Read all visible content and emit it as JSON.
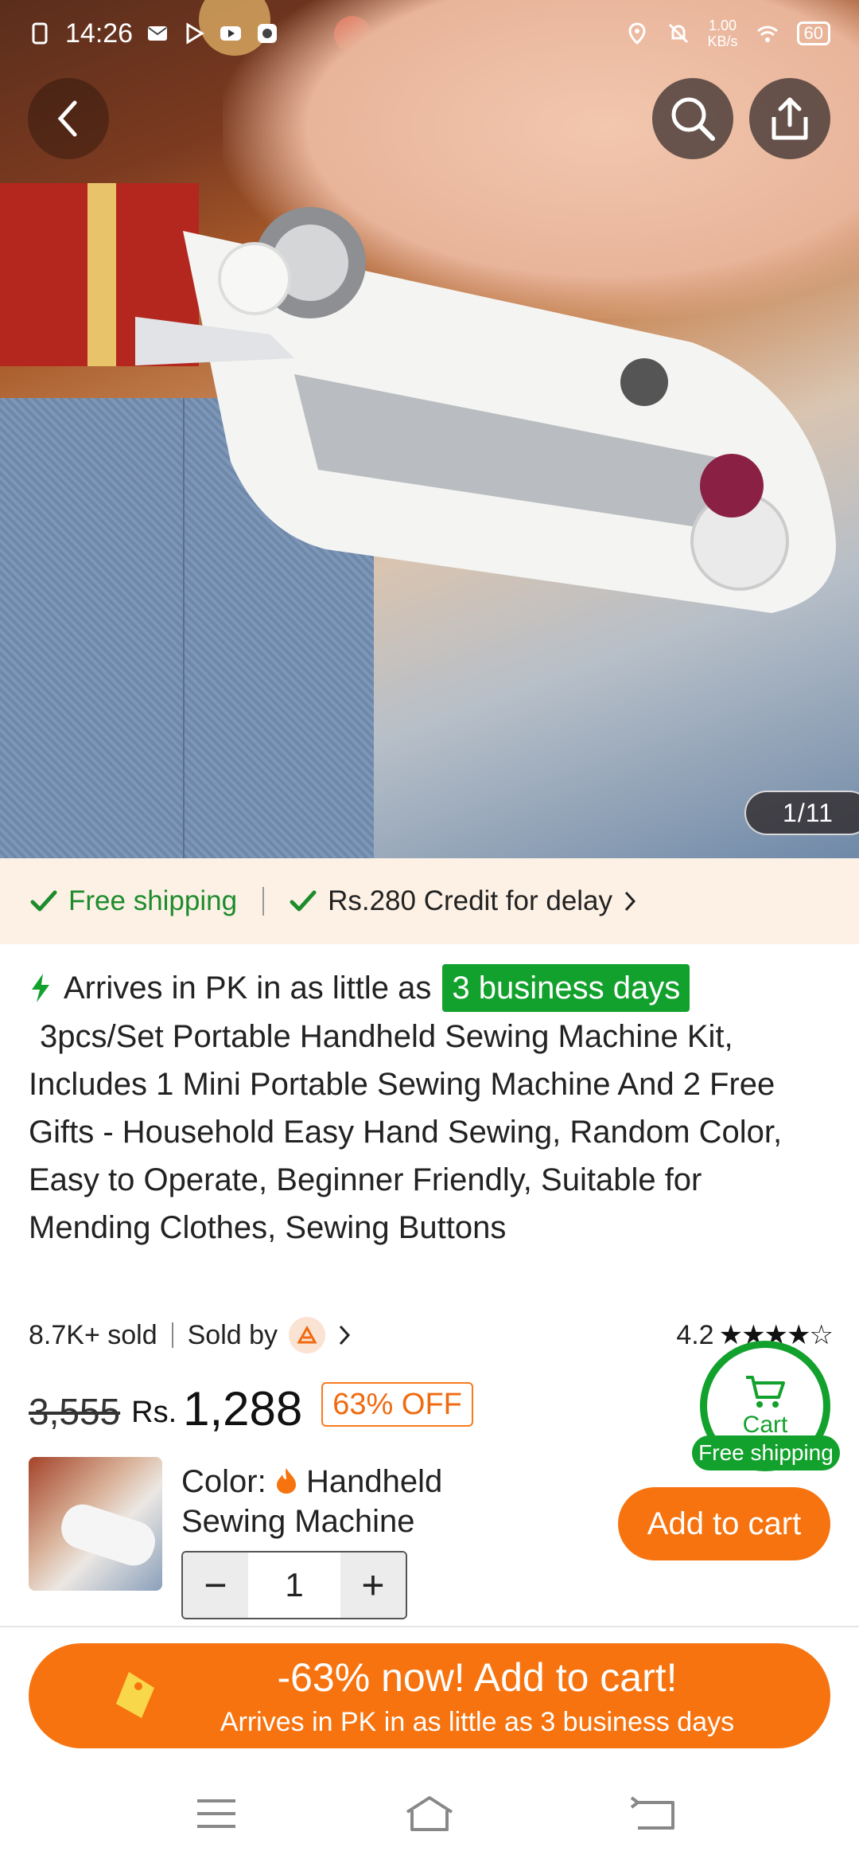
{
  "status_bar": {
    "time": "14:26",
    "net_speed": "1.00\nKB/s",
    "battery": "60"
  },
  "gallery": {
    "counter": "1/11"
  },
  "shipping_strip": {
    "free_shipping": "Free shipping",
    "credit": "Rs.280 Credit for delay"
  },
  "product": {
    "arrives_prefix": "Arrives in PK in as little as",
    "arrives_badge": "3 business days",
    "title": "3pcs/Set Portable Handheld Sewing Machine Kit, Includes 1 Mini Portable Sewing Machine And 2 Free Gifts - Household Easy Hand Sewing, Random Color, Easy to Operate, Beginner Friendly, Suitable for Mending Clothes, Sewing Buttons",
    "sold": "8.7K+ sold",
    "sold_by": "Sold by",
    "rating": "4.2",
    "stars": "★★★★☆"
  },
  "price": {
    "old": "3,555",
    "currency": "Rs.",
    "current": "1,288",
    "discount": "63% OFF"
  },
  "cart_float": {
    "label": "Cart",
    "shipping": "Free shipping"
  },
  "variant": {
    "color_label": "Color:",
    "color_value": "Handheld Sewing Machine",
    "quantity": "1",
    "minus": "−",
    "plus": "+",
    "add_to_cart": "Add to cart"
  },
  "cta": {
    "line1": "-63% now! Add to cart!",
    "line2": "Arrives in PK in as little as 3 business days"
  },
  "colors": {
    "brand_orange": "#f7730f",
    "green": "#12a12c"
  }
}
